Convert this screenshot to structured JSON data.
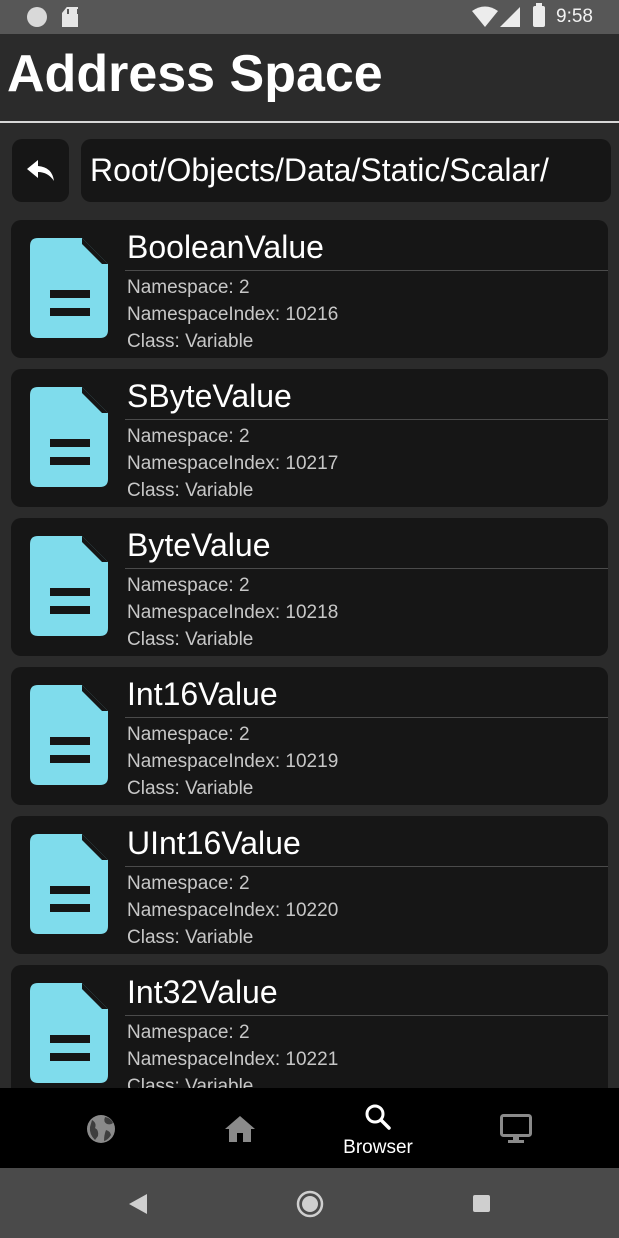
{
  "status_bar": {
    "time": "9:58",
    "icons": [
      "notification-dot-icon",
      "sd-card-icon",
      "wifi-icon",
      "cell-signal-icon",
      "battery-icon"
    ]
  },
  "header": {
    "title": "Address Space"
  },
  "path_bar": {
    "back_icon": "reply-arrow-icon",
    "path": "Root/Objects/Data/Static/Scalar/"
  },
  "nodes": [
    {
      "name": "BooleanValue",
      "namespace": "Namespace: 2",
      "index": "NamespaceIndex: 10216",
      "class": "Class: Variable",
      "icon": "document-icon"
    },
    {
      "name": "SByteValue",
      "namespace": "Namespace: 2",
      "index": "NamespaceIndex: 10217",
      "class": "Class: Variable",
      "icon": "document-icon"
    },
    {
      "name": "ByteValue",
      "namespace": "Namespace: 2",
      "index": "NamespaceIndex: 10218",
      "class": "Class: Variable",
      "icon": "document-icon"
    },
    {
      "name": "Int16Value",
      "namespace": "Namespace: 2",
      "index": "NamespaceIndex: 10219",
      "class": "Class: Variable",
      "icon": "document-icon"
    },
    {
      "name": "UInt16Value",
      "namespace": "Namespace: 2",
      "index": "NamespaceIndex: 10220",
      "class": "Class: Variable",
      "icon": "document-icon"
    },
    {
      "name": "Int32Value",
      "namespace": "Namespace: 2",
      "index": "NamespaceIndex: 10221",
      "class": "Class: Variable",
      "icon": "document-icon"
    }
  ],
  "bottom_nav": {
    "items": [
      {
        "icon": "globe-icon",
        "label": ""
      },
      {
        "icon": "home-icon",
        "label": ""
      },
      {
        "icon": "search-icon",
        "label": "Browser",
        "active": true
      },
      {
        "icon": "monitor-icon",
        "label": ""
      }
    ]
  },
  "system_nav": {
    "icons": [
      "back-triangle-icon",
      "home-circle-icon",
      "recents-square-icon"
    ]
  },
  "colors": {
    "background": "#2b2b2b",
    "card": "#161616",
    "accent_icon": "#7fdcec",
    "status_bar": "#575757",
    "bottom_nav": "#000000",
    "system_nav": "#4a4a4a"
  }
}
